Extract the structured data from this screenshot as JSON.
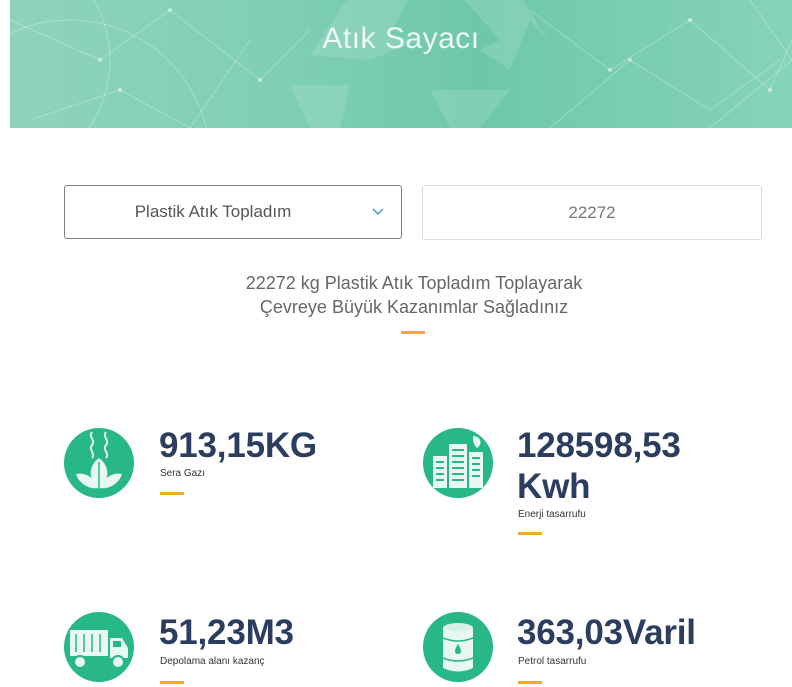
{
  "header": {
    "title": "Atık Sayacı"
  },
  "form": {
    "waste_type_selected": "Plastik Atık Topladım",
    "amount_value": "22272"
  },
  "summary": {
    "line1": "22272 kg Plastik Atık Topladım Toplayarak",
    "line2": "Çevreye Büyük Kazanımlar Sağladınız"
  },
  "stats": [
    {
      "value": "913,15KG",
      "label": "Sera Gazı",
      "icon": "leaf-icon"
    },
    {
      "value_line1": "128598,53",
      "value_line2": "Kwh",
      "label": "Enerji tasarrufu",
      "icon": "building-icon"
    },
    {
      "value": "51,23M3",
      "label": "Depolama alanı kazanç",
      "icon": "truck-icon"
    },
    {
      "value": "363,03Varil",
      "label": "Petrol tasarrufu",
      "icon": "barrel-icon"
    }
  ],
  "colors": {
    "accent": "#f0ad22",
    "icon_green": "#27b886",
    "value_text": "#2c3e5f",
    "hero_green": "#7fcfb4"
  }
}
